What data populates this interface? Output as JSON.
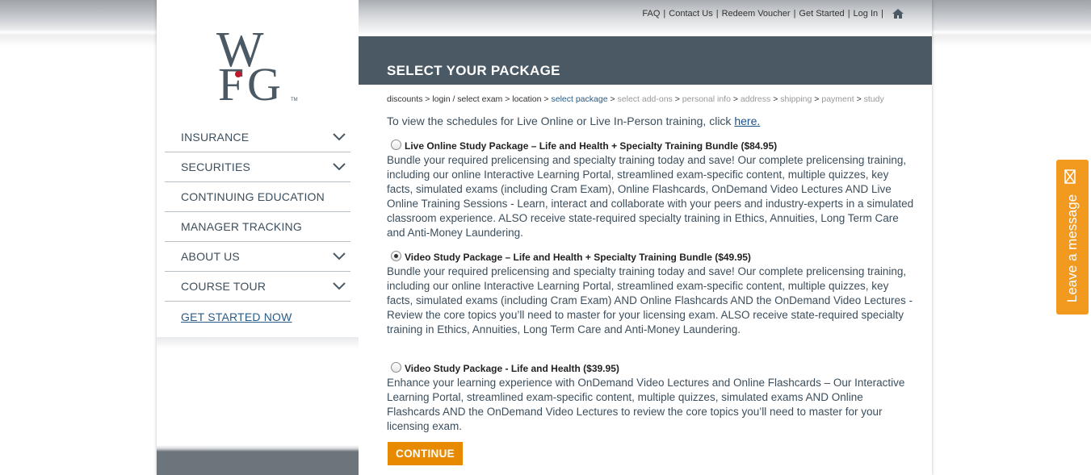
{
  "logo": {
    "letters": "WFG",
    "tm": "TM"
  },
  "sidebar": {
    "items": [
      {
        "label": "INSURANCE",
        "has_chevron": true
      },
      {
        "label": "SECURITIES",
        "has_chevron": true
      },
      {
        "label": "CONTINUING EDUCATION",
        "has_chevron": false
      },
      {
        "label": "MANAGER TRACKING",
        "has_chevron": false
      },
      {
        "label": "ABOUT US",
        "has_chevron": true
      },
      {
        "label": "COURSE TOUR",
        "has_chevron": true
      },
      {
        "label": "GET STARTED NOW",
        "has_chevron": false
      }
    ]
  },
  "utility_links": [
    "FAQ",
    "Contact Us",
    "Redeem Voucher",
    "Get Started",
    "Log In"
  ],
  "header": {
    "title": "SELECT YOUR PACKAGE"
  },
  "breadcrumb": {
    "steps": [
      "discounts",
      "login / select exam",
      "location",
      "select package",
      "select add-ons",
      "personal info",
      "address",
      "shipping",
      "payment",
      "study"
    ],
    "separator": ">"
  },
  "intro": {
    "text": "To view the schedules for Live Online or Live In-Person training, click ",
    "link": "here."
  },
  "packages": [
    {
      "title": "Live Online Study Package – Life and Health + Specialty Training Bundle ($84.95)",
      "selected": false,
      "description": "Bundle your required prelicensing and specialty training today and save! Our complete prelicensing training, including our online Interactive Learning Portal, streamlined exam-specific content, multiple quizzes, key facts, simulated exams (including Cram Exam), Online Flashcards, OnDemand Video Lectures AND Live Online Training Sessions - Learn, interact and collaborate with your peers and industry-experts in a simulated classroom experience. ALSO receive state-required specialty training in Ethics, Annuities, Long Term Care and Anti-Money Laundering."
    },
    {
      "title": "Video Study Package – Life and Health + Specialty Training Bundle ($49.95)",
      "selected": true,
      "description": "Bundle your required prelicensing and specialty training today and save! Our complete prelicensing training, including our online Interactive Learning Portal, streamlined exam-specific content, multiple quizzes, key facts, simulated exams (including Cram Exam) AND Online Flashcards AND the OnDemand Video Lectures - Review the core topics you’ll need to master for your licensing exam. ALSO receive state-required specialty training in Ethics, Annuities, Long Term Care and Anti-Money Laundering."
    },
    {
      "title": "Video Study Package - Life and Health ($39.95)",
      "selected": false,
      "description": "Enhance your learning experience with OnDemand Video Lectures and Online Flashcards – Our Interactive Learning Portal, streamlined exam-specific content, multiple quizzes, simulated exams AND Online Flashcards AND the OnDemand Video Lectures to review the core topics you’ll need to master for your licensing exam."
    }
  ],
  "continue_label": "CONTINUE",
  "chat_tab": {
    "label": "Leave a message",
    "icon": "envelope-icon"
  },
  "colors": {
    "header": "#4a5964",
    "accent": "#e88a00",
    "chat": "#f29a1f",
    "nav_text": "#3c4e5c",
    "link": "#2a5b86"
  }
}
